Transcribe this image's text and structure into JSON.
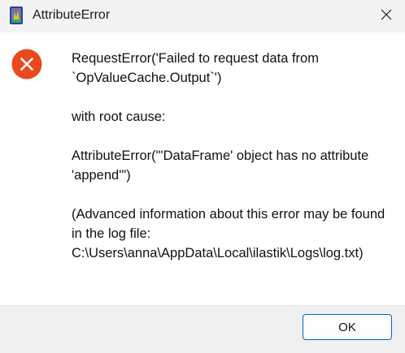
{
  "window": {
    "title": "AttributeError",
    "app_icon": "ilastik-app-icon",
    "close_icon": "close-icon"
  },
  "dialog": {
    "icon": "error-icon",
    "icon_color": "#e8491d",
    "message_lines": {
      "line1": "RequestError('Failed to request data from `OpValueCache.Output`')",
      "line2": "with root cause:",
      "line3": "AttributeError(\"'DataFrame' object has no attribute 'append'\")",
      "line4": "(Advanced information about this error may be found in the log file: C:\\Users\\anna\\AppData\\Local\\ilastik\\Logs\\log.txt)"
    }
  },
  "footer": {
    "ok_label": "OK",
    "accent_color": "#0067c0"
  }
}
